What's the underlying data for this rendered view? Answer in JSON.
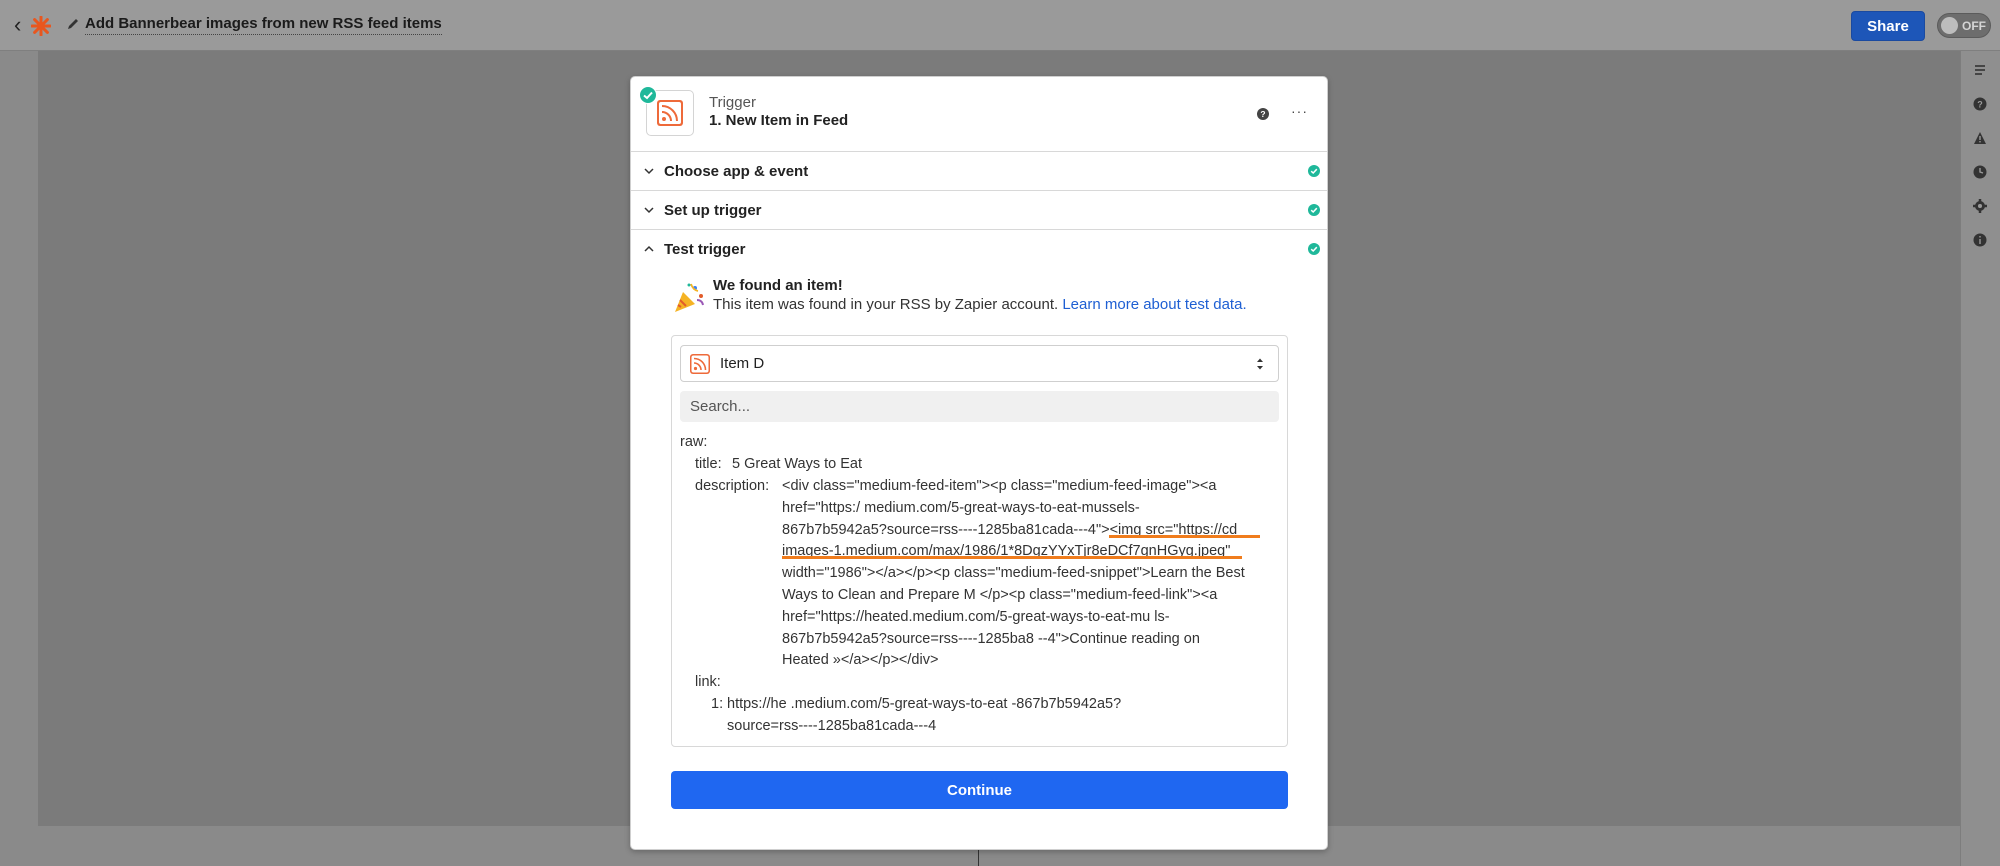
{
  "topbar": {
    "title": "Add Bannerbear images from new RSS feed items",
    "share_label": "Share",
    "toggle_label": "OFF"
  },
  "trigger": {
    "type_label": "Trigger",
    "name": "1. New Item in Feed"
  },
  "sections": [
    {
      "title": "Choose app & event",
      "status": "complete"
    },
    {
      "title": "Set up trigger",
      "status": "complete"
    },
    {
      "title": "Test trigger",
      "status": "complete"
    }
  ],
  "test_result": {
    "title": "We found an item!",
    "text": "This item was found in your RSS by Zapier account.",
    "link_text": "Learn more about test data."
  },
  "item_select": {
    "value": "Item D"
  },
  "search": {
    "placeholder": "Search..."
  },
  "raw": {
    "label": "raw:",
    "title_key": "title:",
    "title_value": "5 Great Ways to Eat",
    "description_key": "description:",
    "description_lines": [
      "<div class=\"medium-feed-item\"><p class=\"medium-feed-image\"><a",
      "href=\"https:/                  medium.com/5-great-ways-to-eat-mussels-",
      "867b7b5942a5?source=rss----1285ba81cada---4\"><img src=\"https://cd",
      "images-1.medium.com/max/1986/1*8DgzYYxTjr8eDCf7gnHGyg.jpeg\"",
      "width=\"1986\"></a></p><p class=\"medium-feed-snippet\">Learn the Best",
      "Ways to Clean and Prepare M          </p><p class=\"medium-feed-link\"><a",
      "href=\"https://heated.medium.com/5-great-ways-to-eat-mu      ls-",
      "867b7b5942a5?source=rss----1285ba8          --4\">Continue reading on",
      "Heated »</a></p></div>"
    ],
    "link_key": "link:",
    "link_index": "1:",
    "link_lines": [
      "https://he        .medium.com/5-great-ways-to-eat               -867b7b5942a5?",
      "source=rss----1285ba81cada---4"
    ]
  },
  "continue_label": "Continue",
  "colors": {
    "accent_blue": "#1f67f1",
    "success_green": "#1fb89a",
    "rss_orange": "#ee6a3a",
    "highlight_orange": "#f07c1c"
  },
  "icons": [
    "chevron-left-icon",
    "zapier-logo-icon",
    "pencil-icon",
    "rss-icon",
    "check-circle-icon",
    "help-icon",
    "more-icon",
    "chevron-down-icon",
    "chevron-up-icon",
    "party-popper-icon",
    "sort-arrows-icon"
  ]
}
